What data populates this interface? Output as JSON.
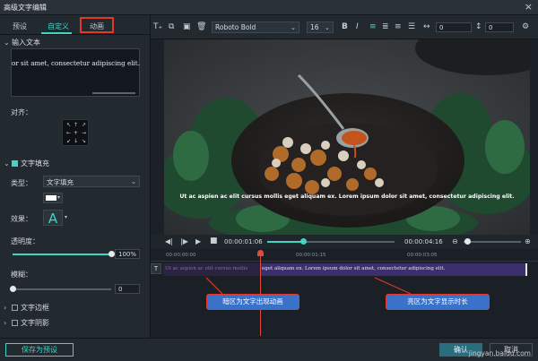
{
  "window": {
    "title": "高级文字编辑",
    "close": "×"
  },
  "tabs": [
    {
      "label": "预设"
    },
    {
      "label": "自定义"
    },
    {
      "label": "动画"
    }
  ],
  "input_section": {
    "title": "输入文本",
    "text": "or sit amet, consectetur adipiscing elit."
  },
  "align": {
    "label": "对齐：",
    "arrows": [
      "↖",
      "↑",
      "↗",
      "←",
      "+",
      "→",
      "↙",
      "↓",
      "↘"
    ]
  },
  "fill": {
    "title": "文字填充",
    "type_label": "类型：",
    "type_value": "文字填充",
    "effect_label": "效果：",
    "effect_glyph": "A",
    "opacity_label": "透明度：",
    "opacity_value": "100%",
    "opacity_fraction": 1.0,
    "blur_label": "模糊：",
    "blur_value": "0"
  },
  "border": {
    "title": "文字边框"
  },
  "shadow": {
    "title": "文字阴影"
  },
  "toolbar": {
    "font": "Roboto Bold",
    "size": "16",
    "bold": "B",
    "italic": "I",
    "spacing": "0",
    "line_spacing": "0"
  },
  "preview": {
    "caption": "Ut ac aspien ac elit cursus mollis eget aliquam ex. Lorem ipsum dolor sit amet, consectetur adipiscing elit."
  },
  "playback": {
    "current": "00:00:01:06",
    "total": "00:00:04:16",
    "progress_fraction": 0.28
  },
  "timeline": {
    "ticks": [
      "00:00:00:00",
      "00:00:01:15",
      "00:00:03:05"
    ],
    "clip_text_dim": "Ut ac aspien ac elit cursus mollis",
    "clip_text_bright": "eget aliquam ex. Lorem ipsum dolor sit amet, consectetur adipiscing elit.",
    "track_icon": "T",
    "annotations": [
      "暗区为文字出现动画",
      "亮区为文字显示时长"
    ]
  },
  "buttons": {
    "save_preset": "保存为预设",
    "ok": "确认",
    "cancel": "取消"
  },
  "watermark": "jingyan.baidu.com",
  "colors": {
    "accent": "#3fd6c8",
    "annotation_red": "#e0382a",
    "bubble_blue": "#3a72c9"
  }
}
